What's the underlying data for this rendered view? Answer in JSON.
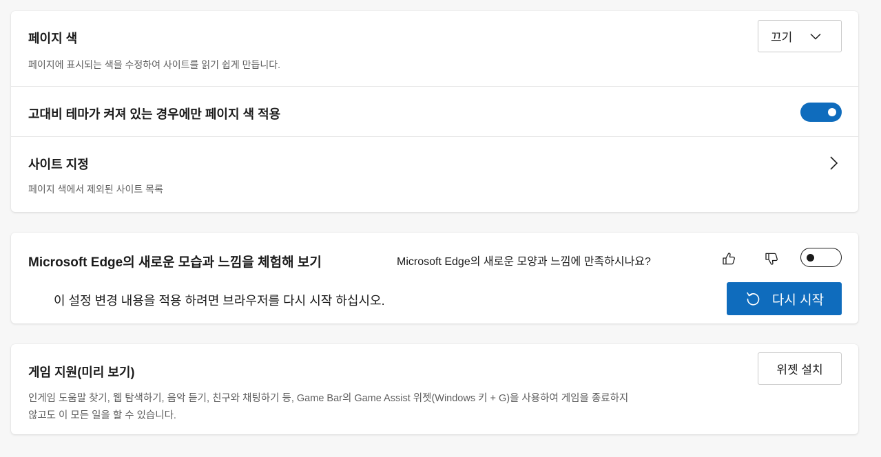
{
  "page_colors": {
    "title": "페이지 색",
    "description": "페이지에 표시되는 색을 수정하여 사이트를 읽기 쉽게 만듭니다.",
    "dropdown_value": "끄기",
    "high_contrast_label": "고대비 테마가 켜져 있는 경우에만 페이지 색 적용",
    "high_contrast_enabled": true,
    "site_exceptions_title": "사이트 지정",
    "site_exceptions_description": "페이지 색에서 제외된 사이트 목록"
  },
  "new_look": {
    "title": "Microsoft Edge의 새로운 모습과 느낌을 체험해 보기",
    "feedback_question": "Microsoft Edge의 새로운 모양과 느낌에 만족하시나요?",
    "enabled": false,
    "restart_note": "이 설정 변경 내용을 적용 하려면 브라우저를 다시 시작 하십시오.",
    "restart_button": "다시 시작"
  },
  "game_assist": {
    "title": "게임 지원(미리 보기)",
    "install_button": "위젯 설치",
    "description_line1": "인게임 도움말 찾기, 웹 탐색하기, 음악 듣기, 친구와 채팅하기 등, Game Bar의 Game Assist 위젯(Windows 키 + G)을 사용하여 게임을 종료하지",
    "description_line2": "않고도 이 모든 일을 할 수 있습니다."
  },
  "colors": {
    "accent": "#0f6cbd",
    "background": "#f7f7f7",
    "card": "#ffffff"
  },
  "icons": [
    "chevron-down-icon",
    "chevron-right-icon",
    "thumbs-up-icon",
    "thumbs-down-icon",
    "restart-icon"
  ]
}
